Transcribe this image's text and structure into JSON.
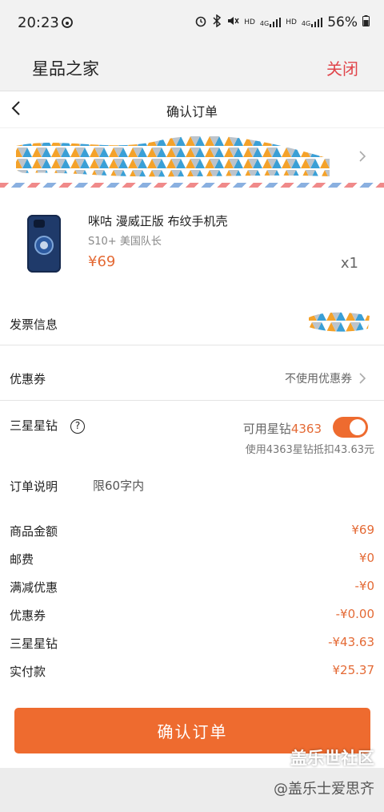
{
  "status_bar": {
    "time": "20:23",
    "battery": "56%",
    "icons": [
      "sync-icon",
      "alarm-icon",
      "bluetooth-icon",
      "mute-icon",
      "hd-icon",
      "4g-signal-icon",
      "hd-icon",
      "4g-signal-icon",
      "battery-icon"
    ],
    "hd1": "HD",
    "net1": "4G",
    "hd2": "HD",
    "net2": "4G"
  },
  "app": {
    "title": "星品之家",
    "close_label": "关闭",
    "accent_color": "#e0454b"
  },
  "page": {
    "title": "确认订单"
  },
  "product": {
    "name": "咪咕 漫威正版 布纹手机壳",
    "variant": "S10+ 美国队长",
    "price": "¥69",
    "quantity": "x1"
  },
  "invoice": {
    "label": "发票信息"
  },
  "coupon": {
    "label": "优惠券",
    "value": "不使用优惠券"
  },
  "diamond": {
    "label": "三星星钻",
    "help": "?",
    "available_prefix": "可用星钻",
    "available_count": "4363",
    "toggle_on": true,
    "description": "使用4363星钻抵扣43.63元"
  },
  "note": {
    "label": "订单说明",
    "placeholder": "限60字内"
  },
  "summary": [
    {
      "label": "商品金额",
      "value": "¥69"
    },
    {
      "label": "邮费",
      "value": "¥0"
    },
    {
      "label": "满减优惠",
      "value": "-¥0"
    },
    {
      "label": "优惠券",
      "value": "-¥0.00"
    },
    {
      "label": "三星星钻",
      "value": "-¥43.63"
    },
    {
      "label": "实付款",
      "value": "¥25.37"
    }
  ],
  "confirm_button": "确认订单",
  "watermark": {
    "line1": "盖乐世社区",
    "line2": "@盖乐士爱思齐"
  },
  "colors": {
    "accent_orange": "#ee6b2f",
    "price_orange": "#e46a35"
  }
}
